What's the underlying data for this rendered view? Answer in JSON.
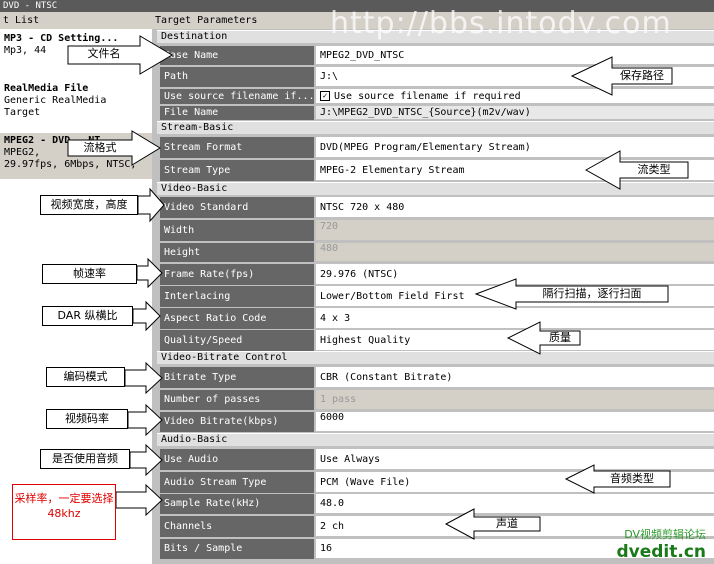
{
  "window": {
    "title": "DVD - NTSC"
  },
  "left_panel": {
    "header": "t List",
    "items": [
      {
        "title": "MP3 - CD Setting...",
        "sub1": "Mp3, 44",
        "sub2": ""
      },
      {
        "title": "RealMedia File",
        "sub1": "Generic RealMedia",
        "sub2": "Target"
      },
      {
        "title": "MPEG2 - DVD - NT",
        "sub1": "MPEG2,",
        "sub2": "29.97fps, 6Mbps, NTSC,"
      }
    ]
  },
  "right_panel": {
    "header": "Target Parameters"
  },
  "sections": {
    "destination": "Destination",
    "stream_basic": "Stream-Basic",
    "video_basic": "Video-Basic",
    "video_bitrate": "Video-Bitrate Control",
    "audio_basic": "Audio-Basic"
  },
  "params": {
    "base_name": {
      "label": "Base Name",
      "value": "MPEG2_DVD_NTSC"
    },
    "path": {
      "label": "Path",
      "value": "J:\\"
    },
    "use_source": {
      "label": "Use source filename if...",
      "value": "Use source filename if required",
      "checked": true
    },
    "file_name": {
      "label": "File Name",
      "value": "J:\\MPEG2_DVD_NTSC_{Source}(m2v/wav)"
    },
    "stream_format": {
      "label": "Stream Format",
      "value": "DVD(MPEG Program/Elementary Stream)"
    },
    "stream_type": {
      "label": "Stream Type",
      "value": "MPEG-2 Elementary Stream"
    },
    "video_standard": {
      "label": "Video Standard",
      "value": "NTSC 720 x 480"
    },
    "width": {
      "label": "Width",
      "value": "720"
    },
    "height": {
      "label": "Height",
      "value": "480"
    },
    "frame_rate": {
      "label": "Frame Rate(fps)",
      "value": "29.976 (NTSC)"
    },
    "interlacing": {
      "label": "Interlacing",
      "value": "Lower/Bottom Field First"
    },
    "aspect_ratio": {
      "label": "Aspect Ratio Code",
      "value": "4 x 3"
    },
    "quality": {
      "label": "Quality/Speed",
      "value": "Highest Quality"
    },
    "bitrate_type": {
      "label": "Bitrate Type",
      "value": "CBR (Constant Bitrate)"
    },
    "passes": {
      "label": "Number of passes",
      "value": "1 pass"
    },
    "video_bitrate": {
      "label": "Video Bitrate(kbps)",
      "value": "6000"
    },
    "use_audio": {
      "label": "Use Audio",
      "value": "Use Always"
    },
    "audio_stream_type": {
      "label": "Audio Stream Type",
      "value": "PCM (Wave File)"
    },
    "sample_rate": {
      "label": "Sample Rate(kHz)",
      "value": "48.0"
    },
    "channels": {
      "label": "Channels",
      "value": "2 ch"
    },
    "bits_sample": {
      "label": "Bits / Sample",
      "value": "16"
    }
  },
  "annotations": {
    "file_name": "文件名",
    "save_path": "保存路径",
    "stream_format": "流格式",
    "stream_type": "流类型",
    "video_size": "视频宽度，高度",
    "frame_rate": "帧速率",
    "interlace": "隔行扫描，逐行扫面",
    "dar": "DAR 纵横比",
    "quality": "质量",
    "encode_mode": "编码模式",
    "video_bitrate": "视频码率",
    "use_audio": "是否使用音频",
    "sample_rate_line1": "采样率，一定要选择",
    "sample_rate_line2": "48khz",
    "audio_type": "音频类型",
    "channels": "声道"
  },
  "watermark": "http://bbs.intodv.com",
  "logo": {
    "line1": "DV视频剪辑论坛",
    "line2": "dvedit.cn"
  },
  "colors": {
    "label_bg": "#666666",
    "section_bg": "#e0e0e0",
    "value_bg": "#ffffff",
    "callout_red": "#e00000"
  }
}
